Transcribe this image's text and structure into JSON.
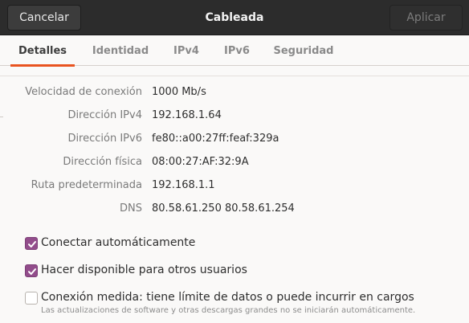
{
  "header": {
    "cancel_label": "Cancelar",
    "title": "Cableada",
    "apply_label": "Aplicar"
  },
  "tabs": [
    {
      "label": "Detalles",
      "active": true
    },
    {
      "label": "Identidad",
      "active": false
    },
    {
      "label": "IPv4",
      "active": false
    },
    {
      "label": "IPv6",
      "active": false
    },
    {
      "label": "Seguridad",
      "active": false
    }
  ],
  "details": [
    {
      "label": "Velocidad de conexión",
      "value": "1000 Mb/s"
    },
    {
      "label": "Dirección IPv4",
      "value": "192.168.1.64"
    },
    {
      "label": "Dirección IPv6",
      "value": "fe80::a00:27ff:feaf:329a"
    },
    {
      "label": "Dirección física",
      "value": "08:00:27:AF:32:9A"
    },
    {
      "label": "Ruta predeterminada",
      "value": "192.168.1.1"
    },
    {
      "label": "DNS",
      "value": "80.58.61.250 80.58.61.254"
    }
  ],
  "options": [
    {
      "label": "Conectar automáticamente",
      "checked": true
    },
    {
      "label": "Hacer disponible para otros usuarios",
      "checked": true
    },
    {
      "label": "Conexión medida: tiene límite de datos o puede incurrir en cargos",
      "checked": false,
      "sublabel": "Las actualizaciones de software y otras descargas grandes no se iniciarán automáticamente."
    }
  ],
  "colors": {
    "accent_tab": "#e95420",
    "checkbox": "#924d8b",
    "headerbar": "#2c2c2c"
  }
}
